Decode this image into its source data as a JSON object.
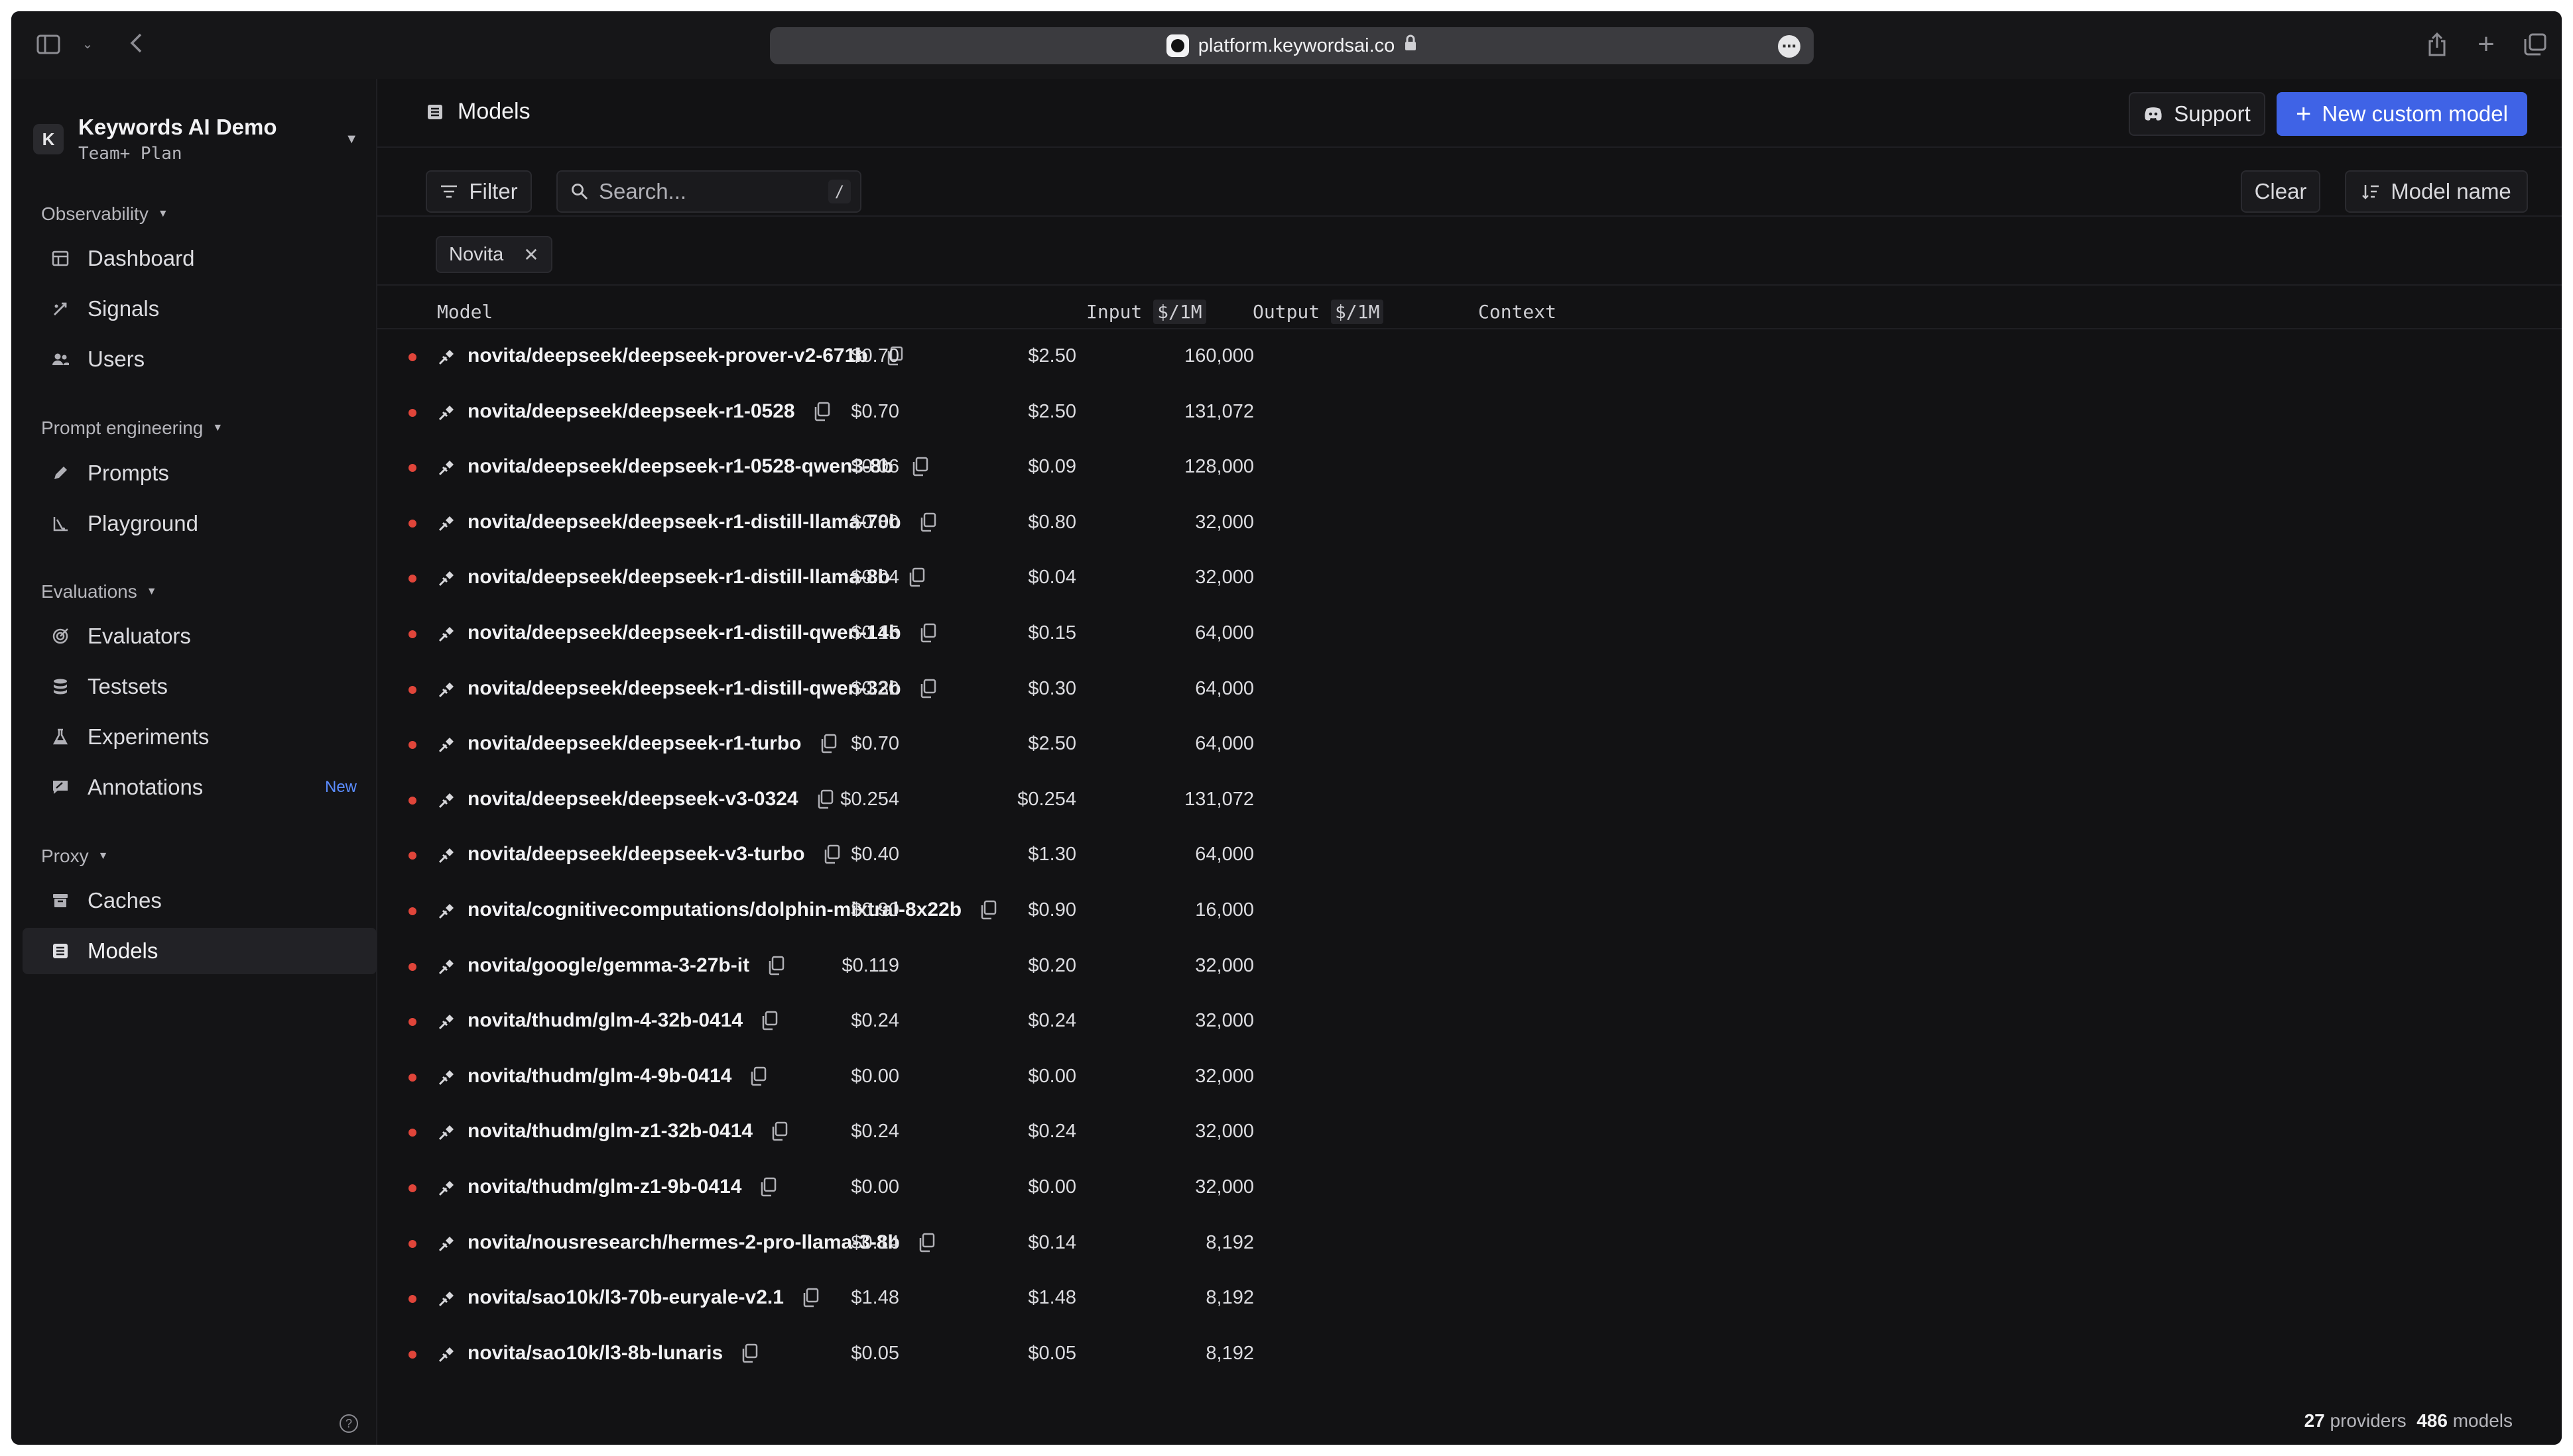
{
  "browser": {
    "url": "platform.keywordsai.co"
  },
  "workspace": {
    "initial": "K",
    "name": "Keywords AI Demo",
    "plan": "Team+ Plan"
  },
  "sidebar": {
    "sections": [
      {
        "label": "Observability",
        "items": [
          {
            "label": "Dashboard",
            "icon": "dashboard-icon"
          },
          {
            "label": "Signals",
            "icon": "signals-icon"
          },
          {
            "label": "Users",
            "icon": "users-icon"
          }
        ]
      },
      {
        "label": "Prompt engineering",
        "items": [
          {
            "label": "Prompts",
            "icon": "pencil-icon"
          },
          {
            "label": "Playground",
            "icon": "playground-icon"
          }
        ]
      },
      {
        "label": "Evaluations",
        "items": [
          {
            "label": "Evaluators",
            "icon": "target-icon"
          },
          {
            "label": "Testsets",
            "icon": "database-icon"
          },
          {
            "label": "Experiments",
            "icon": "flask-icon"
          },
          {
            "label": "Annotations",
            "icon": "annotation-icon",
            "badge": "New"
          }
        ]
      },
      {
        "label": "Proxy",
        "items": [
          {
            "label": "Caches",
            "icon": "archive-icon"
          },
          {
            "label": "Models",
            "icon": "models-icon",
            "active": true
          }
        ]
      }
    ]
  },
  "header": {
    "title": "Models",
    "support_label": "Support",
    "new_model_label": "New custom model"
  },
  "toolbar": {
    "filter_label": "Filter",
    "search_placeholder": "Search...",
    "search_shortcut": "/",
    "clear_label": "Clear",
    "sort_label": "Model name"
  },
  "filters": {
    "active_chip": "Novita"
  },
  "table": {
    "columns": {
      "model": "Model",
      "input": "Input",
      "input_unit": "$/1M",
      "output": "Output",
      "output_unit": "$/1M",
      "context": "Context"
    },
    "rows": [
      {
        "model": "novita/deepseek/deepseek-prover-v2-671b",
        "input": "$0.70",
        "output": "$2.50",
        "context": "160,000"
      },
      {
        "model": "novita/deepseek/deepseek-r1-0528",
        "input": "$0.70",
        "output": "$2.50",
        "context": "131,072"
      },
      {
        "model": "novita/deepseek/deepseek-r1-0528-qwen3-8b",
        "input": "$0.06",
        "output": "$0.09",
        "context": "128,000"
      },
      {
        "model": "novita/deepseek/deepseek-r1-distill-llama-70b",
        "input": "$0.80",
        "output": "$0.80",
        "context": "32,000"
      },
      {
        "model": "novita/deepseek/deepseek-r1-distill-llama-8b",
        "input": "$0.04",
        "output": "$0.04",
        "context": "32,000"
      },
      {
        "model": "novita/deepseek/deepseek-r1-distill-qwen-14b",
        "input": "$0.15",
        "output": "$0.15",
        "context": "64,000"
      },
      {
        "model": "novita/deepseek/deepseek-r1-distill-qwen-32b",
        "input": "$0.30",
        "output": "$0.30",
        "context": "64,000"
      },
      {
        "model": "novita/deepseek/deepseek-r1-turbo",
        "input": "$0.70",
        "output": "$2.50",
        "context": "64,000"
      },
      {
        "model": "novita/deepseek/deepseek-v3-0324",
        "input": "$0.254",
        "output": "$0.254",
        "context": "131,072"
      },
      {
        "model": "novita/deepseek/deepseek-v3-turbo",
        "input": "$0.40",
        "output": "$1.30",
        "context": "64,000"
      },
      {
        "model": "novita/cognitivecomputations/dolphin-mixtral-8x22b",
        "input": "$0.90",
        "output": "$0.90",
        "context": "16,000"
      },
      {
        "model": "novita/google/gemma-3-27b-it",
        "input": "$0.119",
        "output": "$0.20",
        "context": "32,000"
      },
      {
        "model": "novita/thudm/glm-4-32b-0414",
        "input": "$0.24",
        "output": "$0.24",
        "context": "32,000"
      },
      {
        "model": "novita/thudm/glm-4-9b-0414",
        "input": "$0.00",
        "output": "$0.00",
        "context": "32,000"
      },
      {
        "model": "novita/thudm/glm-z1-32b-0414",
        "input": "$0.24",
        "output": "$0.24",
        "context": "32,000"
      },
      {
        "model": "novita/thudm/glm-z1-9b-0414",
        "input": "$0.00",
        "output": "$0.00",
        "context": "32,000"
      },
      {
        "model": "novita/nousresearch/hermes-2-pro-llama-3-8b",
        "input": "$0.14",
        "output": "$0.14",
        "context": "8,192"
      },
      {
        "model": "novita/sao10k/l3-70b-euryale-v2.1",
        "input": "$1.48",
        "output": "$1.48",
        "context": "8,192"
      },
      {
        "model": "novita/sao10k/l3-8b-lunaris",
        "input": "$0.05",
        "output": "$0.05",
        "context": "8,192"
      }
    ]
  },
  "footer": {
    "providers_count": "27",
    "providers_label": "providers",
    "models_count": "486",
    "models_label": "models"
  },
  "colors": {
    "accent": "#3f63e6",
    "status_dot": "#e0453a",
    "new_badge": "#5b8cff"
  }
}
